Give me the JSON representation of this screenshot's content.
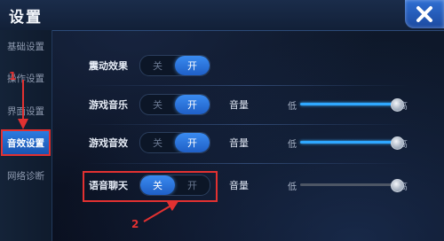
{
  "window": {
    "title": "设置"
  },
  "sidebar": {
    "items": [
      {
        "label": "基础设置",
        "active": false
      },
      {
        "label": "操作设置",
        "active": false
      },
      {
        "label": "界面设置",
        "active": false
      },
      {
        "label": "音效设置",
        "active": true
      },
      {
        "label": "网络诊断",
        "active": false
      }
    ]
  },
  "settings": {
    "vibration": {
      "label": "震动效果",
      "off_label": "关",
      "on_label": "开",
      "state": "on"
    },
    "music": {
      "label": "游戏音乐",
      "off_label": "关",
      "on_label": "开",
      "state": "on",
      "volume_label": "音量",
      "low_label": "低",
      "high_label": "高",
      "volume": 1.0
    },
    "sfx": {
      "label": "游戏音效",
      "off_label": "关",
      "on_label": "开",
      "state": "on",
      "volume_label": "音量",
      "low_label": "低",
      "high_label": "高",
      "volume": 1.0
    },
    "voice_chat": {
      "label": "语音聊天",
      "off_label": "关",
      "on_label": "开",
      "state": "off",
      "volume_label": "音量",
      "low_label": "低",
      "high_label": "高",
      "volume": 1.0
    }
  },
  "annotations": {
    "marker_1": "1",
    "marker_2": "2",
    "color": "#e23131"
  },
  "colors": {
    "accent": "#2f8cf0",
    "slider_active": "#2fa8ff",
    "slider_muted": "#4d5665"
  }
}
